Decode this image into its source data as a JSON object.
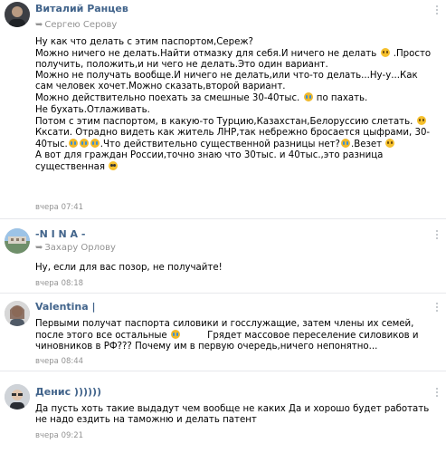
{
  "comments": [
    {
      "author": "Виталий Ранцев",
      "reply_to": "Сергею Серову",
      "time": "вчера 07:41",
      "avatar": "avatar-man-dark",
      "lines": {
        "l1": "Ну как что делать с этим паспортом,Сереж?",
        "l2a": "Можно ничего не делать.Найти отмазку для себя.И ничего не делать",
        "l2b": ".Просто",
        "l3": "получить, положить,и ни чего не делать.Это один вариант.",
        "l4": "Можно не получать вообще.И ничего не делать,или что-то делать...Ну-у...Как",
        "l5": "сам человек хочет.Можно сказать,второй вариант.",
        "l6a": "Можно действительно поехать за смешные 30-40тыс.",
        "l6b": "по пахать.",
        "l7": "Не бухать.Отлаживать.",
        "l8": "Потом с этим паспортом, в какую-то Турцию,Казахстан,Белоруссию слетать.",
        "l9": "Кксати. Отрадно видеть как житель ЛНР,так небрежно бросается цыфрами, 30-",
        "l10a": "40тыс.",
        "l10b": ".Что действительно существенной разницы нет?",
        "l10c": ".Везет",
        "l11": "А вот для граждан России,точно знаю что 30тыс. и 40тыс.,это разница",
        "l12": "существенная"
      }
    },
    {
      "author": "-N I N A -",
      "reply_to": "Захару Орлову",
      "time": "вчера 08:18",
      "avatar": "avatar-landscape",
      "lines": {
        "l1": "Ну, если для вас позор, не получайте!"
      }
    },
    {
      "author": "Valentina |",
      "reply_to": "",
      "time": "вчера 08:44",
      "avatar": "avatar-woman",
      "lines": {
        "l1": "Первыми получат паспорта силовики и госслужащие, затем члены их семей,",
        "l2a": "после этого все остальные",
        "l2b": "Грядет массовое переселение силовиков и",
        "l3": "чиновников в РФ??? Почему им в первую очередь,ничего непонятно..."
      }
    },
    {
      "author": "Денис ))))))",
      "reply_to": "",
      "time": "вчера 09:21",
      "avatar": "avatar-man-glasses",
      "lines": {
        "l1": "Да пусть хоть такие выдадут чем вообще не каких Да и хорошо будет работать",
        "l2": "не надо ездить на таможню и делать патент"
      }
    }
  ],
  "colors": {
    "author": "#42648b",
    "meta": "#939393",
    "separator": "#e7e8ec"
  },
  "icons": {
    "menu": "more-vertical-icon",
    "reply": "reply-arrow-icon",
    "emoji": "emoji-icon"
  }
}
